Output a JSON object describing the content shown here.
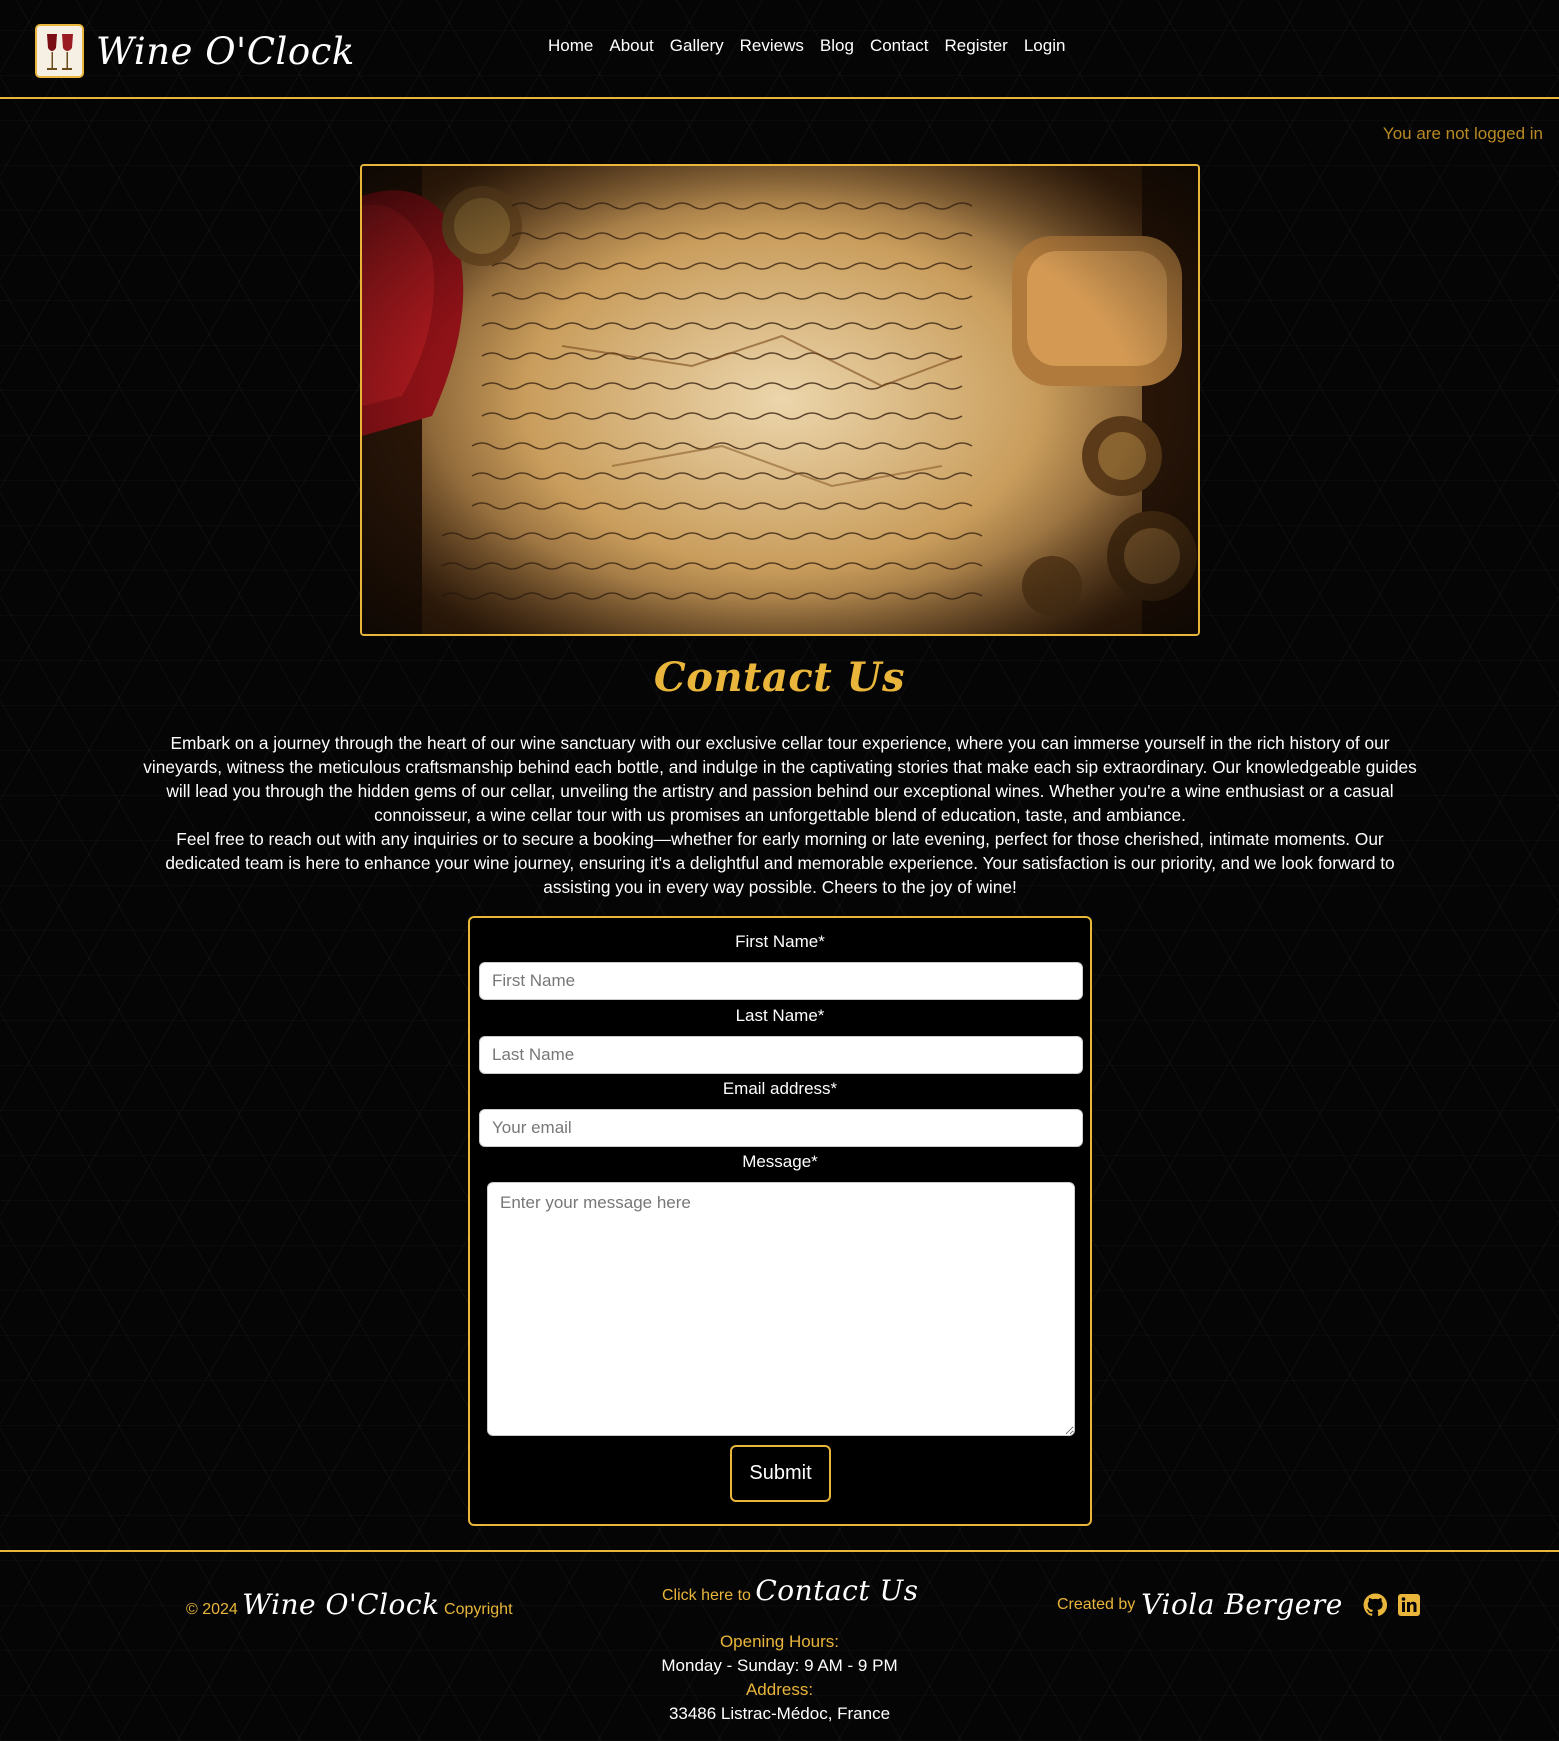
{
  "brand": {
    "name": "Wine O'Clock"
  },
  "nav": {
    "items": [
      "Home",
      "About",
      "Gallery",
      "Reviews",
      "Blog",
      "Contact",
      "Register",
      "Login"
    ]
  },
  "status": {
    "login_text": "You are not logged in"
  },
  "page": {
    "title": "Contact Us",
    "intro_paragraph_1": "Embark on a journey through the heart of our wine sanctuary with our exclusive cellar tour experience, where you can immerse yourself in the rich history of our vineyards, witness the meticulous craftsmanship behind each bottle, and indulge in the captivating stories that make each sip extraordinary. Our knowledgeable guides will lead you through the hidden gems of our cellar, unveiling the artistry and passion behind our exceptional wines. Whether you're a wine enthusiast or a casual connoisseur, a wine cellar tour with us promises an unforgettable blend of education, taste, and ambiance.",
    "intro_paragraph_2": "Feel free to reach out with any inquiries or to secure a booking—whether for early morning or late evening, perfect for those cherished, intimate moments. Our dedicated team is here to enhance your wine journey, ensuring it's a delightful and memorable experience. Your satisfaction is our priority, and we look forward to assisting you in every way possible. Cheers to the joy of wine!"
  },
  "form": {
    "first_name_label": "First Name*",
    "first_name_placeholder": "First Name",
    "first_name_value": "",
    "last_name_label": "Last Name*",
    "last_name_placeholder": "Last Name",
    "last_name_value": "",
    "email_label": "Email address*",
    "email_placeholder": "Your email",
    "email_value": "",
    "message_label": "Message*",
    "message_placeholder": "Enter your message here",
    "message_value": "",
    "submit_label": "Submit"
  },
  "footer": {
    "copy_prefix": "© 2024",
    "copy_brand": "Wine O'Clock",
    "copy_suffix": "Copyright",
    "contact_prefix": "Click here to",
    "contact_link": "Contact Us",
    "created_prefix": "Created by",
    "created_name": "Viola Bergere",
    "icons": [
      "github-icon",
      "linkedin-icon"
    ],
    "hours_label": "Opening Hours:",
    "hours_value": "Monday - Sunday: 9 AM - 9 PM",
    "address_label": "Address:",
    "address_value": "33486 Listrac-Médoc, France"
  },
  "colors": {
    "accent": "#e9b53a",
    "background": "#050505",
    "text": "#ffffff",
    "status_text": "#b98a24"
  }
}
